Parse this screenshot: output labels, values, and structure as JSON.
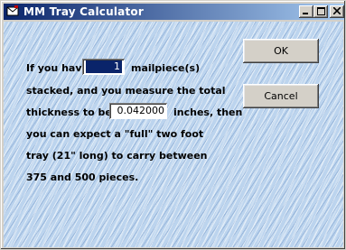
{
  "window": {
    "title": "MM Tray Calculator",
    "icon": "mail-envelope-icon",
    "controls": {
      "minimize": "minimize-icon",
      "maximize": "maximize-icon",
      "close": "close-icon"
    }
  },
  "form": {
    "line1_prefix": "If you have",
    "mailpieces_value": "1",
    "line1_suffix": "mailpiece(s)",
    "line2": "stacked, and you measure the total",
    "line3_prefix": "thickness to be:",
    "thickness_value": "0.042000",
    "line3_suffix": "inches, then",
    "line4": "you can expect a \"full\" two foot",
    "line5": "tray (21\" long) to carry between",
    "line6": "375 and 500 pieces."
  },
  "buttons": {
    "ok": "OK",
    "cancel": "Cancel"
  }
}
